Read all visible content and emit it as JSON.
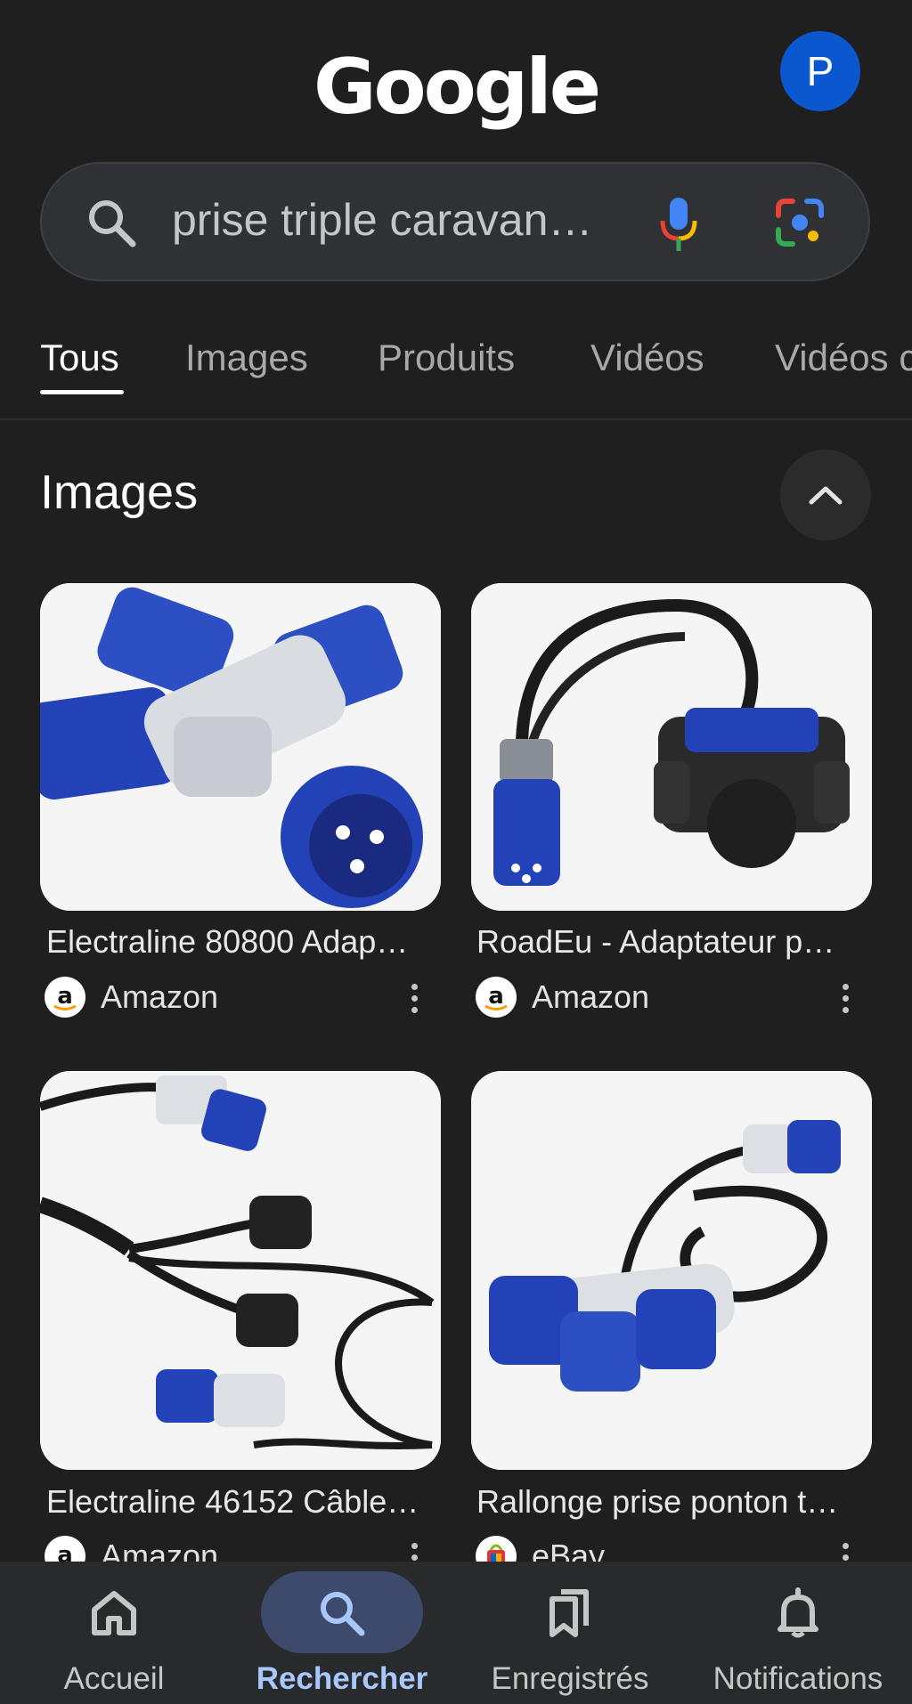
{
  "header": {
    "logo_text": "Google",
    "avatar_letter": "P"
  },
  "search": {
    "query": "prise triple caravan…",
    "icons": [
      "search-icon",
      "mic-icon",
      "lens-icon"
    ]
  },
  "tabs": [
    {
      "label": "Tous",
      "active": true
    },
    {
      "label": "Images",
      "active": false
    },
    {
      "label": "Produits",
      "active": false
    },
    {
      "label": "Vidéos",
      "active": false
    },
    {
      "label": "Vidéos c",
      "active": false
    }
  ],
  "images_section": {
    "title": "Images",
    "results": [
      {
        "title": "Electraline 80800 Adap…",
        "source": "Amazon",
        "source_icon": "amazon-icon"
      },
      {
        "title": "RoadEu - Adaptateur p…",
        "source": "Amazon",
        "source_icon": "amazon-icon"
      },
      {
        "title": "Electraline 46152 Câble…",
        "source": "Amazon",
        "source_icon": "amazon-icon"
      },
      {
        "title": "Rallonge prise ponton t…",
        "source": "eBay",
        "source_icon": "ebay-icon"
      }
    ]
  },
  "bottom_nav": [
    {
      "label": "Accueil",
      "icon": "home-icon",
      "active": false
    },
    {
      "label": "Rechercher",
      "icon": "search-icon",
      "active": true
    },
    {
      "label": "Enregistrés",
      "icon": "bookmarks-icon",
      "active": false
    },
    {
      "label": "Notifications",
      "icon": "bell-icon",
      "active": false
    }
  ],
  "colors": {
    "background": "#1f1f1f",
    "accent": "#a8c7fa",
    "avatar": "#0b57d0",
    "plug_blue": "#2342b8"
  }
}
